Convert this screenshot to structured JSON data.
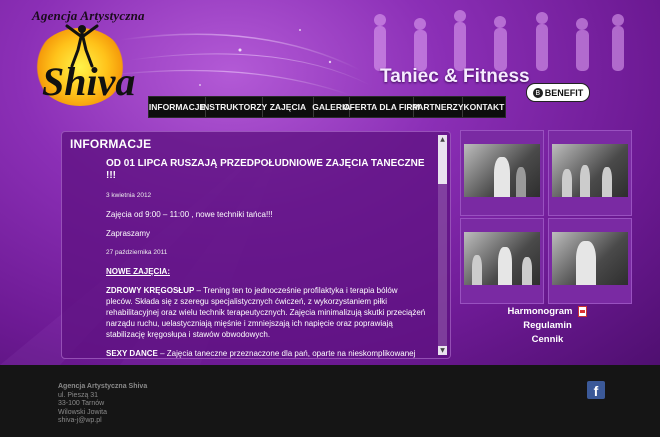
{
  "logo": {
    "agency": "Agencja Artystyczna",
    "name": "Shiva"
  },
  "header": {
    "brand": "Taniec & Fitness",
    "partner_logo": {
      "icon": "B",
      "text": "BENEFIT"
    }
  },
  "nav": {
    "items": [
      {
        "label": "INFORMACJE"
      },
      {
        "label": "INSTRUKTORZY"
      },
      {
        "label": "ZAJĘCIA"
      },
      {
        "label": "GALERIA"
      },
      {
        "label": "OFERTA DLA FIRM"
      },
      {
        "label": "PARTNERZY"
      },
      {
        "label": "KONTAKT"
      }
    ]
  },
  "panel": {
    "heading": "INFORMACJE",
    "post1": {
      "title": "OD 01 LIPCA RUSZAJĄ PRZEDPOŁUDNIOWE ZAJĘCIA TANECZNE !!!",
      "date": "3 kwietnia 2012",
      "body": "Zajęcia od 9:00 – 11:00  , nowe techniki tańca!!!",
      "closing": "Zapraszamy"
    },
    "post2": {
      "date": "27 października 2011",
      "section_title": "NOWE ZAJĘCIA:",
      "item1_title": "ZDROWY KRĘGOSŁUP",
      "item1_text": " – Trening ten to jednocześnie profilaktyka i terapia bólów pleców. Składa się z szeregu specjalistycznych ćwiczeń, z wykorzystaniem piłki rehabilitacyjnej oraz wielu technik terapeutycznych. Zajęcia minimalizują skutki przeciążeń narządu ruchu, uelastyczniają mięśnie i zmniejszają ich napięcie oraz poprawiają stabilizację kręgosłupa i stawów obwodowych.",
      "item2_title": "SEXY DANCE",
      "item2_text": " – Zajęcia taneczne przeznaczone dla pań, oparte na nieskomplikowanej choreografii dającej poczucie seksapilu, zmysłowości, gracji i kobiecości. Świetny sposób na poprawę koordynacji ruchowej, a także nabranie"
    }
  },
  "side_links": {
    "harmonogram": "Harmonogram",
    "regulamin": "Regulamin",
    "cennik": "Cennik"
  },
  "footer": {
    "company": "Agencja Artystyczna Shiva",
    "street": "ul. Pieszą 31",
    "postal": "33-100 Tarnów",
    "place": "Wilowski Jowita",
    "email": "shiva-j@wp.pl"
  },
  "colors": {
    "background_purple": "#8b2fb6",
    "nav_bg": "#0d0d0d",
    "footer_bg": "#151515",
    "facebook_blue": "#3b5998"
  },
  "icons": {
    "facebook": "facebook-icon",
    "pdf": "pdf-icon"
  }
}
